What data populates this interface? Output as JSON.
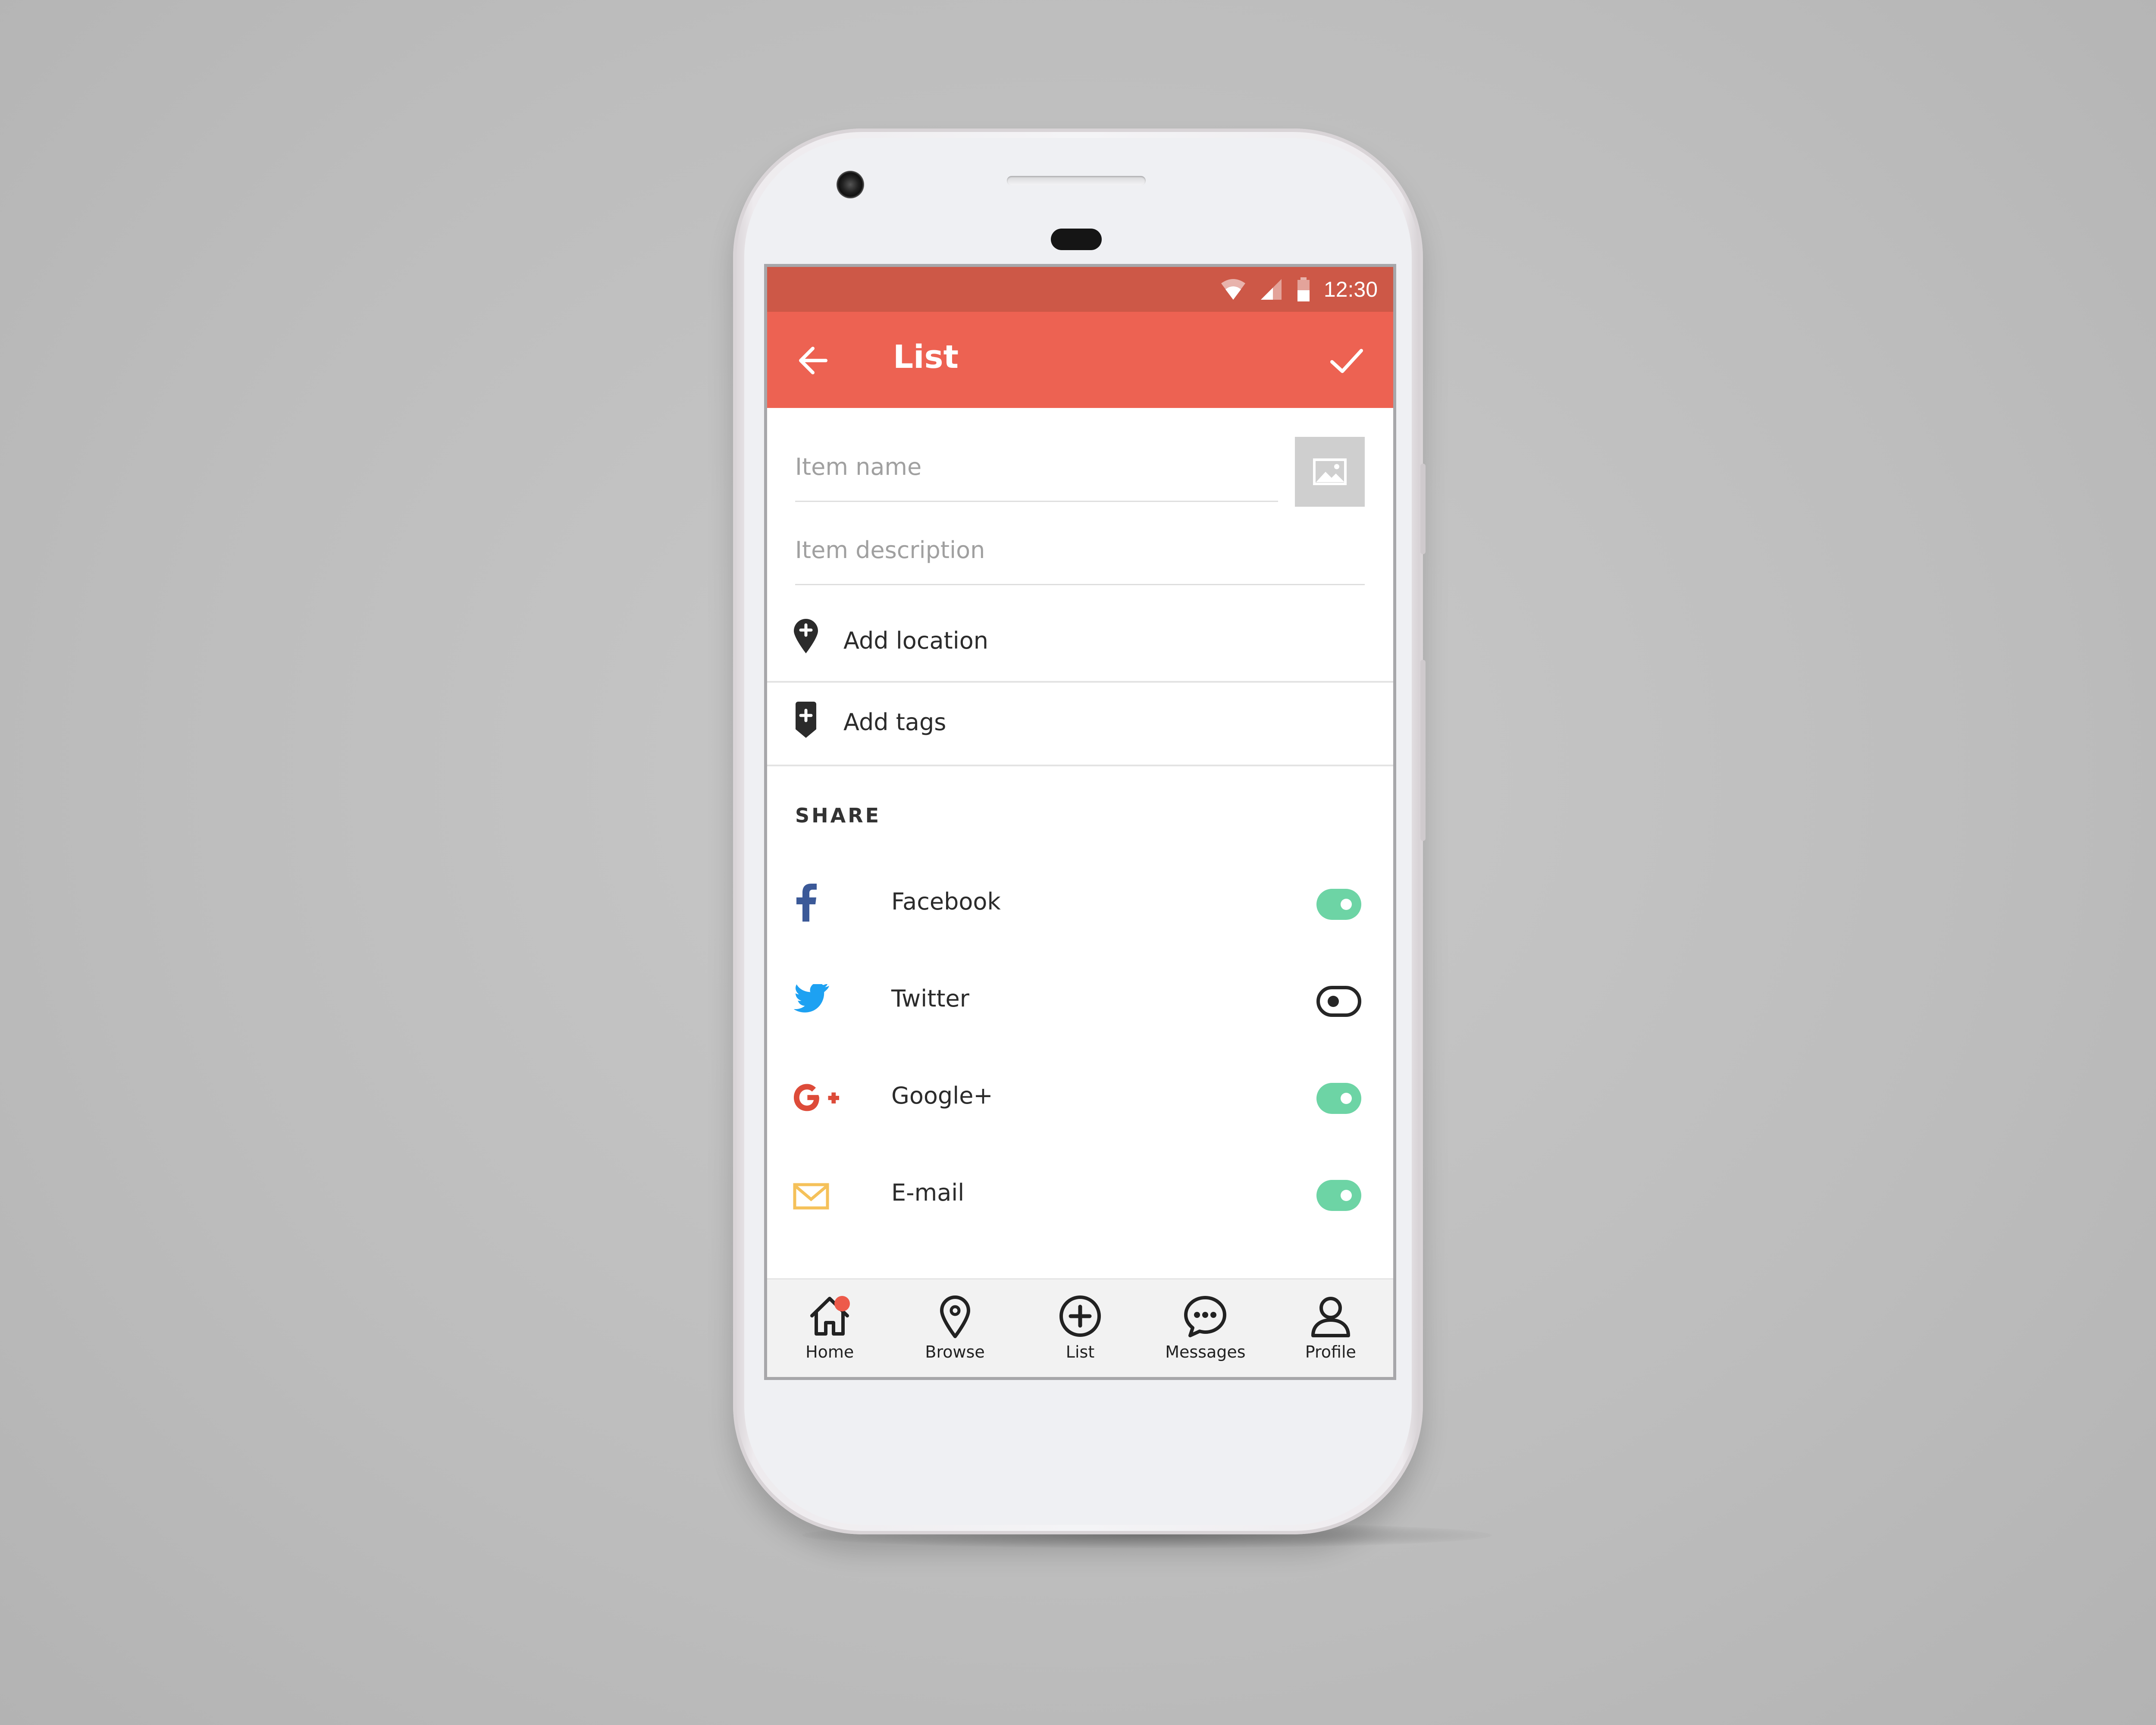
{
  "status_bar": {
    "time": "12:30",
    "icons": [
      "wifi-icon",
      "signal-icon",
      "battery-icon"
    ]
  },
  "app_bar": {
    "title": "List",
    "back_icon": "arrow-left-icon",
    "confirm_icon": "check-icon"
  },
  "form": {
    "item_name_placeholder": "Item name",
    "item_description_placeholder": "Item description",
    "add_location_label": "Add location",
    "add_tags_label": "Add tags"
  },
  "share": {
    "heading": "SHARE",
    "items": [
      {
        "label": "Facebook",
        "icon": "facebook-icon",
        "color": "#3b5998",
        "enabled": true
      },
      {
        "label": "Twitter",
        "icon": "twitter-icon",
        "color": "#1da1f2",
        "enabled": false
      },
      {
        "label": "Google+",
        "icon": "google-plus-icon",
        "color": "#dd4b39",
        "enabled": true
      },
      {
        "label": "E-mail",
        "icon": "mail-icon",
        "color": "#f5c15a",
        "enabled": true
      }
    ]
  },
  "bottom_nav": {
    "items": [
      {
        "label": "Home",
        "icon": "home-icon",
        "badge": true
      },
      {
        "label": "Browse",
        "icon": "location-pin-icon"
      },
      {
        "label": "List",
        "icon": "plus-circle-icon"
      },
      {
        "label": "Messages",
        "icon": "chat-bubble-icon"
      },
      {
        "label": "Profile",
        "icon": "user-icon"
      }
    ]
  },
  "colors": {
    "status_bar": "#cd5847",
    "app_bar": "#ed6252",
    "toggle_on": "#6dd4a5",
    "badge": "#ed5a4a"
  }
}
